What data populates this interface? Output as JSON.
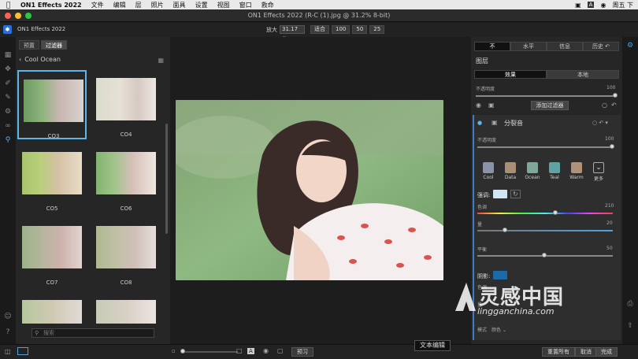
{
  "menubar": {
    "app": "ON1 Effects 2022",
    "items": [
      "文件",
      "编辑",
      "层",
      "照片",
      "面具",
      "设置",
      "视图",
      "窗口",
      "救命"
    ],
    "clock": "周五 下"
  },
  "window": {
    "title": "ON1 Effects 2022 (R-C (1).jpg @ 31.2% 8-bit)"
  },
  "toolbar": {
    "app_name": "ON1 Effects 2022",
    "zoom_label": "放大",
    "zoom_value": "31.17",
    "zoom_fit": "适合",
    "zoom_presets": [
      "100",
      "50",
      "25"
    ]
  },
  "browser": {
    "tabs": [
      "预置",
      "过滤器"
    ],
    "category": "Cool Ocean",
    "thumbnails": [
      "CO3",
      "CO4",
      "CO5",
      "CO6",
      "CO7",
      "CO8",
      "",
      ""
    ],
    "search_placeholder": "搜索"
  },
  "right_panel": {
    "tabs": [
      "不",
      "水平",
      "信息",
      "历史"
    ],
    "layers_title": "图层",
    "subtabs": [
      "效果",
      "本地"
    ],
    "opacity_label": "不透明度",
    "opacity_value": "100",
    "add_filter": "添加过滤器",
    "filter": {
      "name": "分裂音",
      "opacity_label": "不透明度",
      "opacity_value": "100",
      "presets": [
        {
          "name": "Cool",
          "color": "#8a93a8"
        },
        {
          "name": "Data",
          "color": "#a88e72"
        },
        {
          "name": "Ocean",
          "color": "#7ea89a"
        },
        {
          "name": "Teal",
          "color": "#5ea3a2"
        },
        {
          "name": "Warm",
          "color": "#b0917a"
        },
        {
          "name": "更多",
          "color": "#2e2e2e"
        }
      ],
      "highlight_label": "强调:",
      "hue_label": "色调",
      "hue_value": "210",
      "amount_label": "量",
      "amount_value": "20",
      "balance_label": "平衡",
      "balance_value": "50",
      "shadow_label": "阴影:",
      "shadow_hue_label": "色调",
      "shadow_amount_label": "量",
      "mode_label": "模式",
      "mode_value": "颜色"
    }
  },
  "bottombar": {
    "preview": "预习",
    "reset_all": "重置所有",
    "cancel": "取消",
    "done": "完成",
    "tooltip": "文本编辑"
  },
  "watermark": {
    "cn": "灵感中国",
    "en": "lingganchina.com"
  },
  "colors": {
    "accent": "#3f7cc4",
    "selection": "#5fb4ea",
    "highlight_swatch": "#cfe6f6",
    "shadow_swatch": "#1c6aa8"
  }
}
